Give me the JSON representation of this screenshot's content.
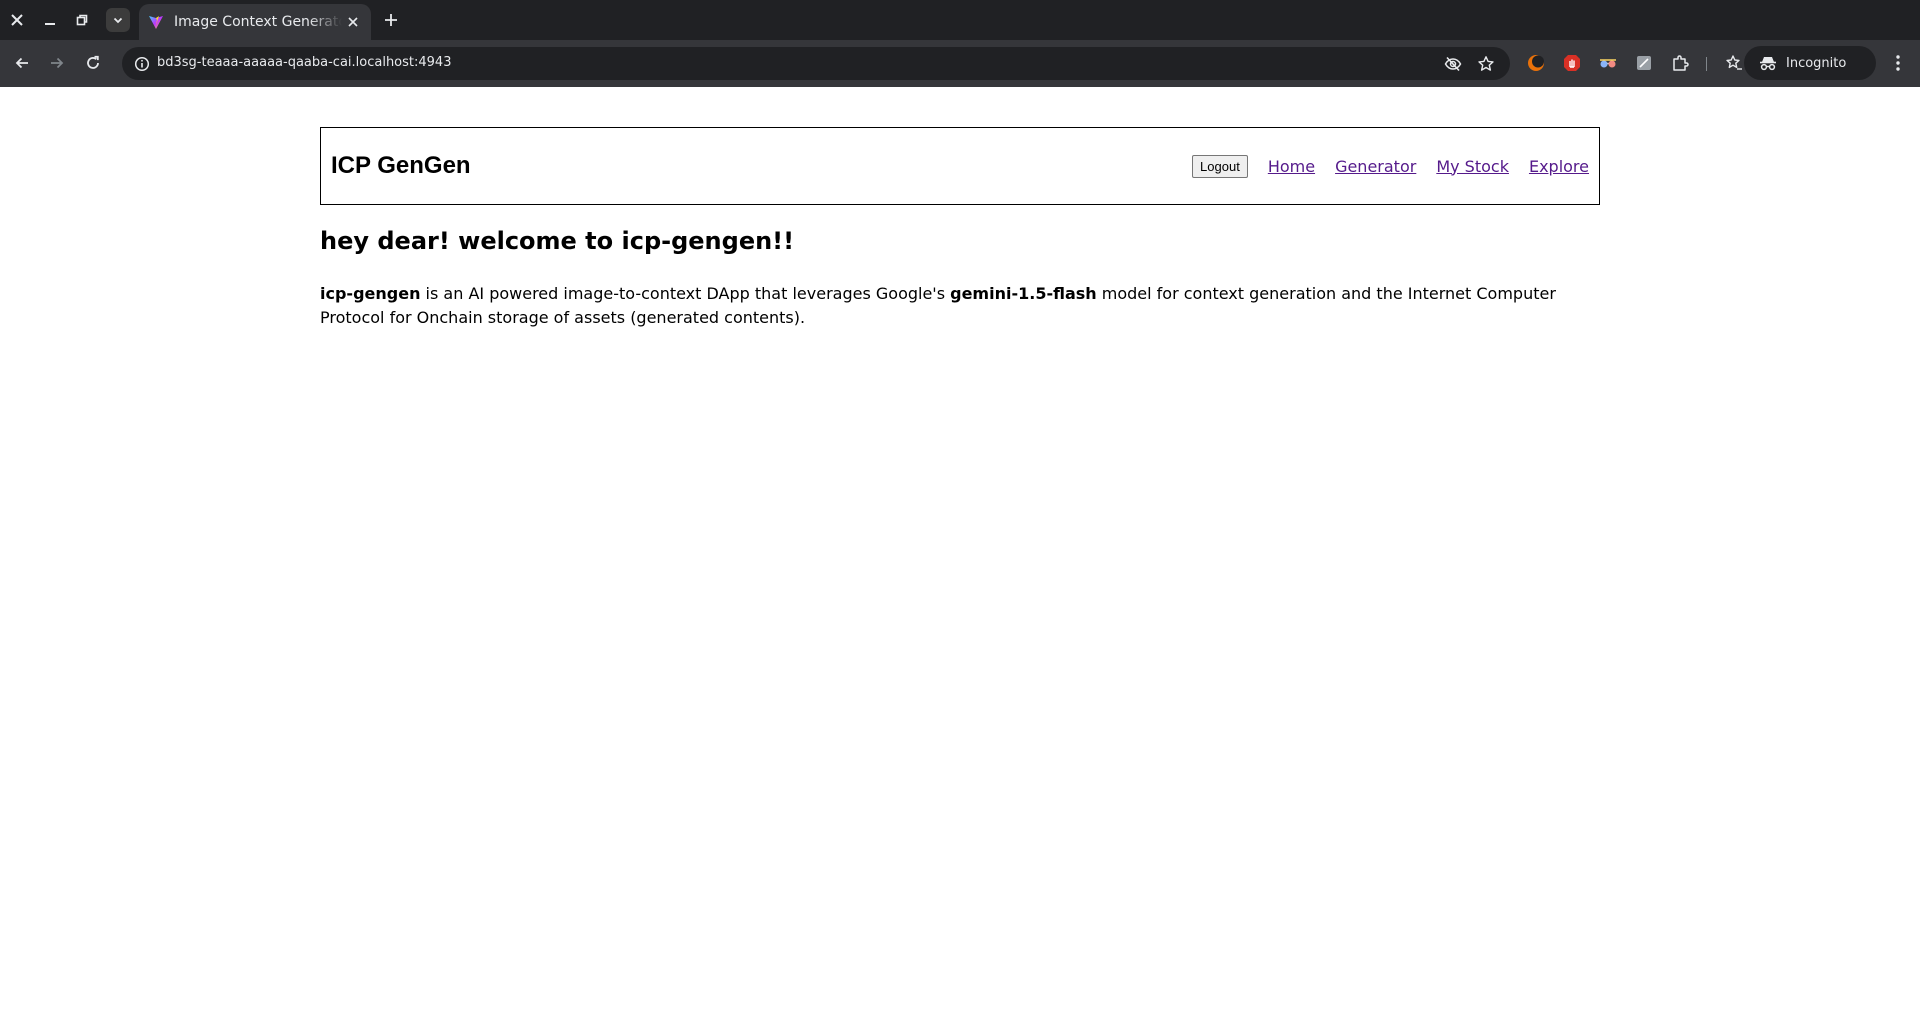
{
  "browser": {
    "tab_title": "Image Context Generator",
    "url": "bd3sg-teaaa-aaaaa-qaaba-cai.localhost:4943",
    "incognito_label": "Incognito"
  },
  "site": {
    "title": "ICP GenGen",
    "logout_label": "Logout",
    "nav": {
      "home": "Home",
      "generator": "Generator",
      "my_stock": "My Stock",
      "explore": "Explore"
    }
  },
  "main": {
    "heading": "hey dear! welcome to icp-gengen!!",
    "intro": {
      "part1_bold": "icp-gengen",
      "part2": " is an AI powered image-to-context DApp that leverages Google's ",
      "part3_bold": "gemini-1.5-flash",
      "part4": " model for context generation and the Internet Computer Protocol for Onchain storage of assets (generated contents)."
    }
  },
  "colors": {
    "chrome_dark": "#202124",
    "chrome_toolbar": "#35363a",
    "link_visited": "#551a8b"
  }
}
